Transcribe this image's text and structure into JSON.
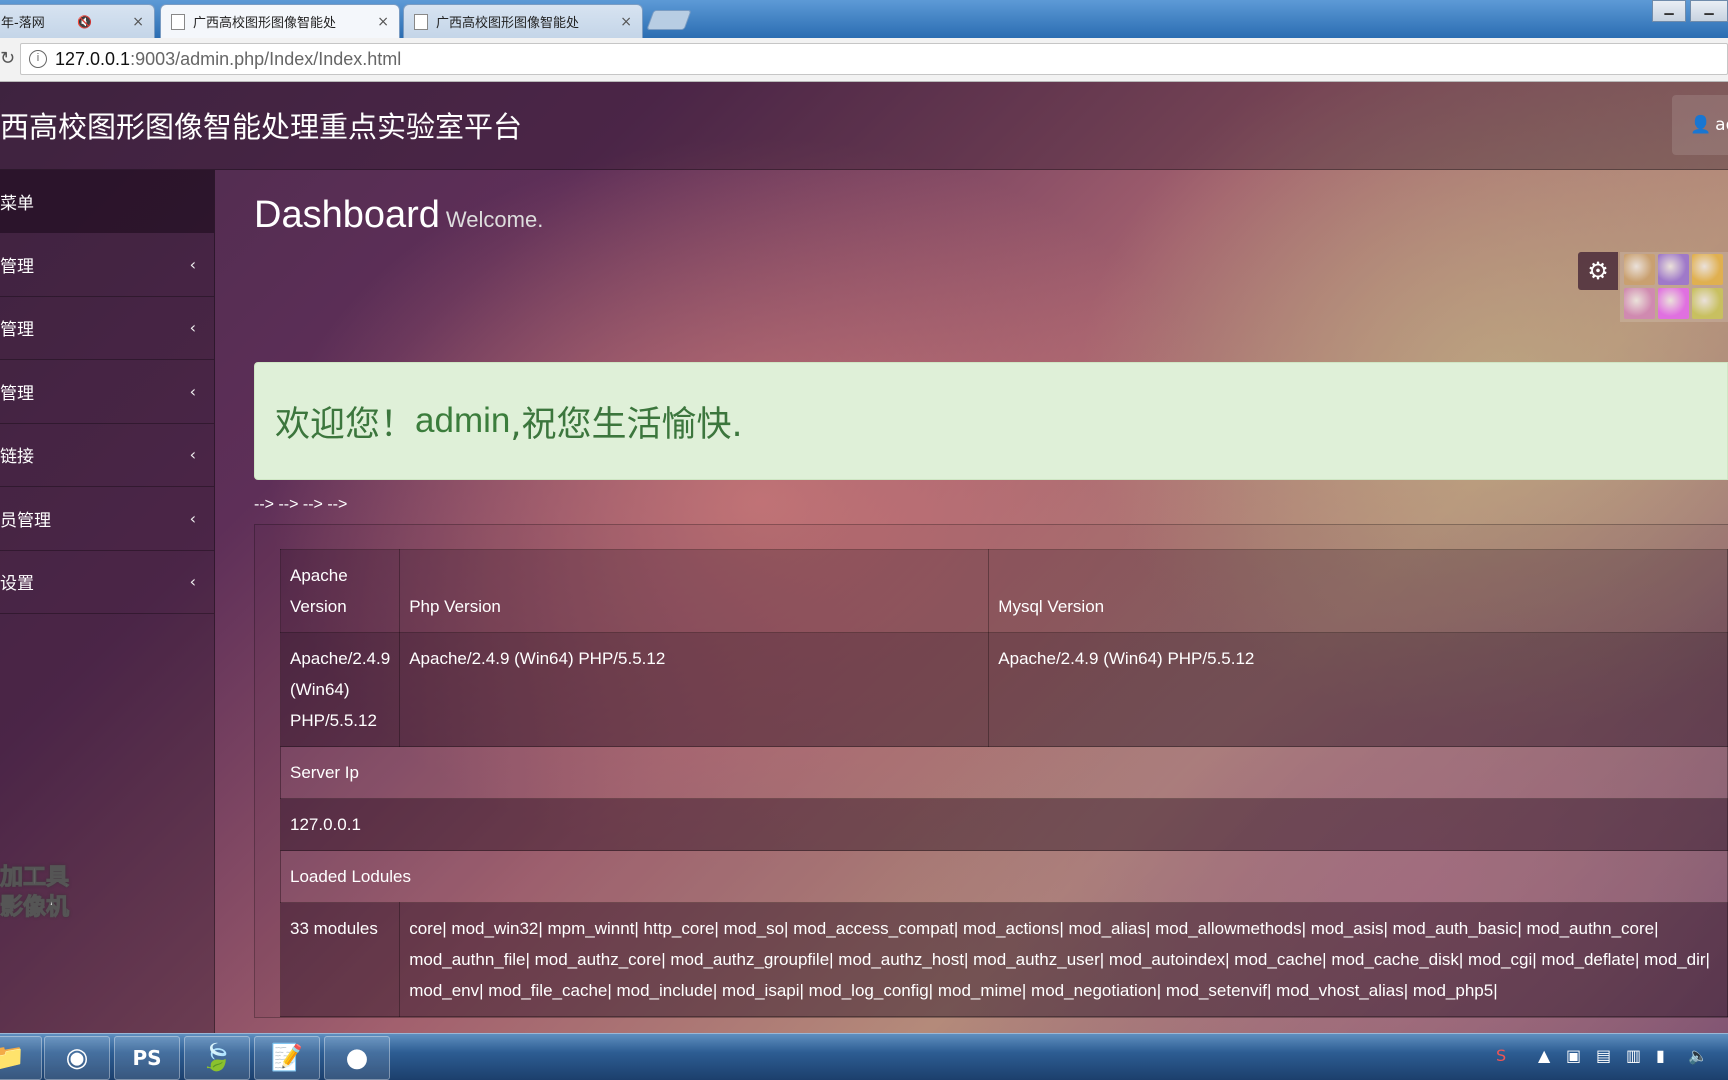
{
  "browser": {
    "tabs": [
      {
        "title": "年-落网",
        "audio_icon": "speaker-muted-icon",
        "close": "×"
      },
      {
        "title": "广西高校图形图像智能处",
        "close": "×"
      },
      {
        "title": "广西高校图形图像智能处",
        "close": "×"
      }
    ],
    "url_host": "127.0.0.1",
    "url_rest": ":9003/admin.php/Index/Index.html"
  },
  "app": {
    "brand": "西高校图形图像智能处理重点实验室平台",
    "user_label": "adm",
    "user_icon": "person-icon"
  },
  "sidebar": {
    "header": "菜单",
    "items": [
      {
        "label": "管理",
        "chevron": "‹"
      },
      {
        "label": "管理",
        "chevron": "‹"
      },
      {
        "label": "管理",
        "chevron": "‹"
      },
      {
        "label": "链接",
        "chevron": "‹"
      },
      {
        "label": "员管理",
        "chevron": "‹"
      },
      {
        "label": "设置",
        "chevron": "‹"
      }
    ]
  },
  "watermark": {
    "line1": "加工具",
    "line2": "影像机"
  },
  "main": {
    "title": "Dashboard",
    "subtitle": "Welcome.",
    "welcome_prefix": "欢迎您！",
    "welcome_user": "admin",
    "welcome_suffix": ",祝您生活愉快.",
    "arrows_text": "--> --> --> -->",
    "skin_colors": [
      "#c9a070",
      "#9f79c9",
      "#e0b050",
      "#d08ab0",
      "#e070e0",
      "#c8c060"
    ]
  },
  "info_table": {
    "headers": [
      "Apache Version",
      "Php Version",
      "Mysql Version"
    ],
    "row1": [
      "Apache/2.4.9 (Win64) PHP/5.5.12",
      "Apache/2.4.9 (Win64) PHP/5.5.12",
      "Apache/2.4.9 (Win64) PHP/5.5.12"
    ],
    "server_ip_label": "Server Ip",
    "server_ip": "127.0.0.1",
    "modules_label": "Loaded Lodules",
    "modules_count": "33 modules",
    "modules_list": "core| mod_win32| mpm_winnt| http_core| mod_so| mod_access_compat| mod_actions| mod_alias| mod_allowmethods| mod_asis| mod_auth_basic| mod_authn_core| mod_authn_file| mod_authz_core| mod_authz_groupfile| mod_authz_host| mod_authz_user| mod_autoindex| mod_cache| mod_cache_disk| mod_cgi| mod_deflate| mod_dir| mod_env| mod_file_cache| mod_include| mod_isapi| mod_log_config| mod_mime| mod_negotiation| mod_setenvif| mod_vhost_alias| mod_php5|"
  },
  "taskbar": {
    "apps": [
      "file-explorer-icon",
      "chrome-icon",
      "phpstorm-icon",
      "app-green-icon",
      "notepad-icon",
      "app-red-icon"
    ],
    "ps_label": "PS"
  }
}
